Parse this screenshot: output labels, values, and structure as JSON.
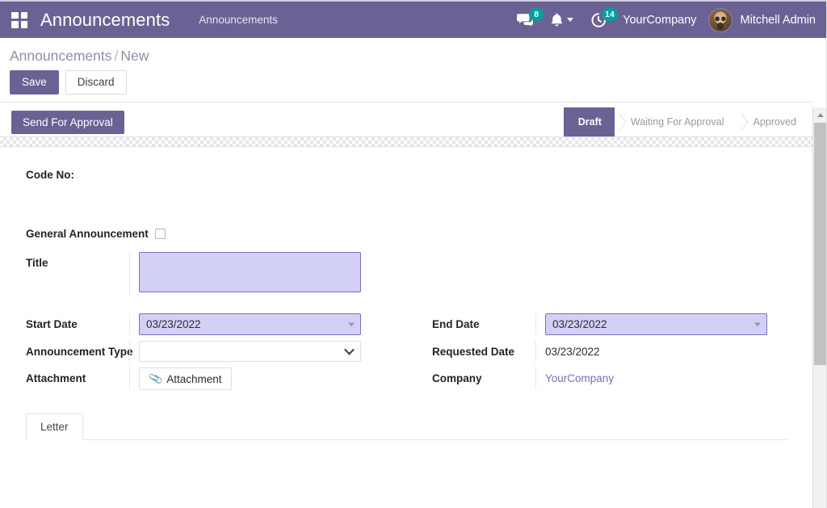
{
  "navbar": {
    "apps_icon": "apps-grid-icon",
    "brand": "Announcements",
    "menu_item": "Announcements",
    "messages": {
      "icon": "messages-icon",
      "count": "8"
    },
    "activities": {
      "icon": "bell-icon"
    },
    "clock": {
      "icon": "clock-icon",
      "count": "14"
    },
    "company": "YourCompany",
    "user": "Mitchell Admin",
    "avatar": "user-avatar"
  },
  "control_panel": {
    "breadcrumb_root": "Announcements",
    "breadcrumb_sep": "/",
    "breadcrumb_current": "New",
    "save_label": "Save",
    "discard_label": "Discard",
    "action_button": "Send For Approval"
  },
  "statusbar": {
    "stages": [
      {
        "label": "Draft",
        "active": true
      },
      {
        "label": "Waiting For Approval",
        "active": false
      },
      {
        "label": "Approved",
        "active": false
      }
    ]
  },
  "form": {
    "code_no_label": "Code No:",
    "code_no_value": "",
    "general_announcement_label": "General Announcement",
    "general_announcement_checked": false,
    "title_label": "Title",
    "title_value": "",
    "title_placeholder": "",
    "start_date_label": "Start Date",
    "start_date_value": "03/23/2022",
    "end_date_label": "End Date",
    "end_date_value": "03/23/2022",
    "announcement_type_label": "Announcement Type",
    "announcement_type_value": "",
    "requested_date_label": "Requested Date",
    "requested_date_value": "03/23/2022",
    "attachment_label": "Attachment",
    "attachment_button": "Attachment",
    "attachment_icon": "paperclip-icon",
    "company_label": "Company",
    "company_value": "YourCompany"
  },
  "notebook": {
    "tabs": [
      {
        "label": "Letter",
        "active": true
      }
    ]
  },
  "colors": {
    "brand_purple": "#6c6194",
    "badge_teal": "#00a09d",
    "field_highlight": "#d2d0f5",
    "field_border": "#7d6fb5",
    "link_purple": "#7b6eae"
  }
}
